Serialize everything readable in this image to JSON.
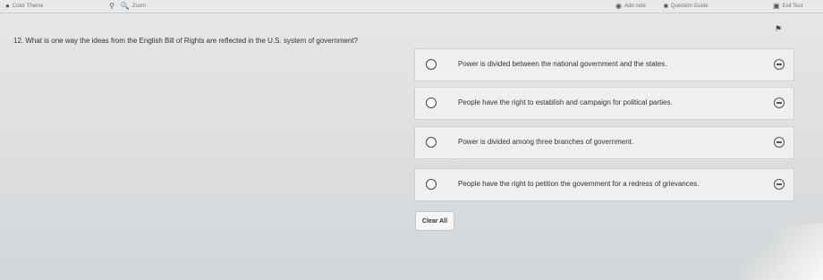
{
  "toolbar": {
    "color_theme": "Color Theme",
    "zoom": "Zoom",
    "add_note": "Add note",
    "question_guide": "Question Guide",
    "exit_test": "Exit Test"
  },
  "question": {
    "number": "12.",
    "text": "What is one way the ideas from the English Bill of Rights are reflected in the U.S. system of government?"
  },
  "options": [
    {
      "label": "Power is divided between the national government and the states."
    },
    {
      "label": "People have the right to establish and campaign for political parties."
    },
    {
      "label": "Power is divided among three branches of government."
    },
    {
      "label": "People have the right to petition the government for a redress of grievances."
    }
  ],
  "clear_all": "Clear All",
  "icons": [
    "palette-icon",
    "zoom-out-icon",
    "zoom-in-icon",
    "note-icon",
    "guide-icon",
    "exit-icon",
    "flag-icon",
    "radio-icon",
    "eliminate-icon"
  ]
}
